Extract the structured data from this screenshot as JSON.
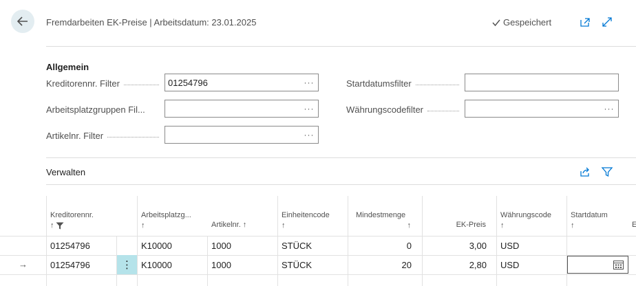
{
  "header": {
    "title": "Fremdarbeiten EK-Preise | Arbeitsdatum: 23.01.2025",
    "saved_label": "Gespeichert"
  },
  "general": {
    "section_title": "Allgemein",
    "fields": {
      "vendor_filter": {
        "label": "Kreditorennr. Filter",
        "value": "01254796"
      },
      "work_center_group_filter": {
        "label": "Arbeitsplatzgruppen Fil...",
        "value": ""
      },
      "item_filter": {
        "label": "Artikelnr. Filter",
        "value": ""
      },
      "start_date_filter": {
        "label": "Startdatumsfilter",
        "value": ""
      },
      "currency_filter": {
        "label": "Währungscodefilter",
        "value": ""
      }
    },
    "ellipsis": "···"
  },
  "manage": {
    "label": "Verwalten"
  },
  "grid": {
    "columns": [
      {
        "label": "Kreditorennr."
      },
      {
        "label": "Arbeitsplatzg..."
      },
      {
        "label": "Artikelnr."
      },
      {
        "label": "Einheitencode"
      },
      {
        "label": "Mindestmenge"
      },
      {
        "label": "EK-Preis"
      },
      {
        "label": "Währungscode"
      },
      {
        "label": "Startdatum"
      },
      {
        "label": "E"
      }
    ],
    "sort_arrow": "↑",
    "rows": [
      {
        "vendor": "01254796",
        "work_center": "K10000",
        "item": "1000",
        "unit": "STÜCK",
        "min_qty": "0",
        "price": "3,00",
        "currency": "USD",
        "start_date": ""
      },
      {
        "vendor": "01254796",
        "work_center": "K10000",
        "item": "1000",
        "unit": "STÜCK",
        "min_qty": "20",
        "price": "2,80",
        "currency": "USD",
        "start_date": ""
      }
    ],
    "row_pointer": "→",
    "row_menu": "⋮"
  },
  "colors": {
    "accent": "#0078d4",
    "back_button_bg": "#e3edf1",
    "row_menu_bg": "#b5e3ea"
  }
}
